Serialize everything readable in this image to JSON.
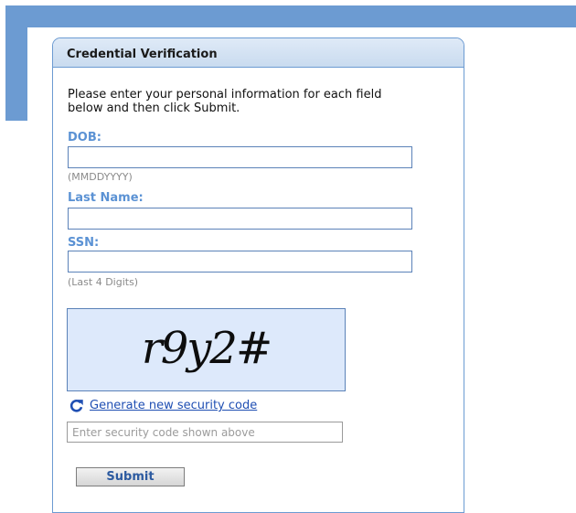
{
  "panel": {
    "title": "Credential Verification",
    "instructions": "Please enter your personal information for each field below and then click Submit."
  },
  "fields": {
    "dob": {
      "label": "DOB:",
      "value": "",
      "hint": "(MMDDYYYY)"
    },
    "last_name": {
      "label": "Last Name:",
      "value": ""
    },
    "ssn": {
      "label": "SSN:",
      "value": "",
      "hint": "(Last 4 Digits)"
    }
  },
  "captcha": {
    "image_text": "r9y2#",
    "refresh_icon": "refresh-icon",
    "refresh_label": "Generate new security code",
    "input_placeholder": "Enter security code shown above",
    "input_value": ""
  },
  "submit_label": "Submit",
  "colors": {
    "accent_blue": "#6c9bd2",
    "label_blue": "#5b92d4",
    "link_blue": "#1f4fb3",
    "captcha_background": "#dde9fb"
  }
}
